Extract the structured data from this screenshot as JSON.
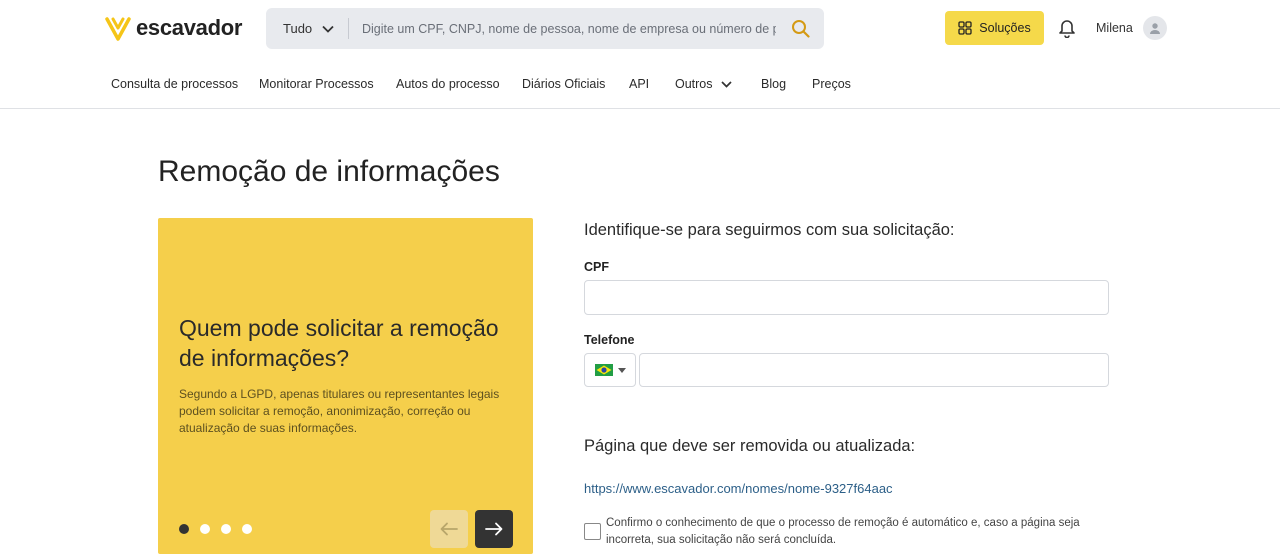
{
  "brand": {
    "name": "escavador",
    "color": "#f5d94a"
  },
  "search": {
    "scope": "Tudo",
    "placeholder": "Digite um CPF, CNPJ, nome de pessoa, nome de empresa ou número de pro…"
  },
  "header": {
    "solucoes_label": "Soluções",
    "user_name": "Milena"
  },
  "nav": {
    "items": [
      {
        "label": "Consulta de processos"
      },
      {
        "label": "Monitorar Processos"
      },
      {
        "label": "Autos do processo"
      },
      {
        "label": "Diários Oficiais"
      },
      {
        "label": "API"
      },
      {
        "label": "Outros"
      },
      {
        "label": "Blog"
      },
      {
        "label": "Preços"
      }
    ]
  },
  "page": {
    "title": "Remoção de informações"
  },
  "card": {
    "title": "Quem pode solicitar a remoção de informações?",
    "text": "Segundo a LGPD, apenas titulares ou representantes legais podem solicitar a remoção, anonimização, correção ou atualização de suas informações.",
    "slides_total": 4,
    "active_slide": 1
  },
  "form": {
    "heading": "Identifique-se para seguirmos com sua solicitação:",
    "cpf_label": "CPF",
    "cpf_value": "",
    "phone_label": "Telefone",
    "phone_value": "",
    "page_heading": "Página que deve ser removida ou atualizada:",
    "page_url": "https://www.escavador.com/nomes/nome-9327f64aac",
    "confirm_text": "Confirmo o conhecimento de que o processo de remoção é automático e, caso a página seja incorreta, sua solicitação não será concluída.",
    "confirm_checked": false
  }
}
